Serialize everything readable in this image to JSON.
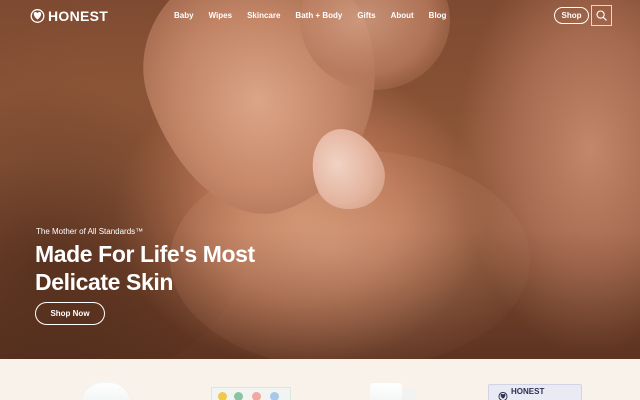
{
  "nav": {
    "brand": "HONEST",
    "logo_icon": "butterfly-icon",
    "links": [
      "Baby",
      "Wipes",
      "Skincare",
      "Bath + Body",
      "Gifts",
      "About",
      "Blog"
    ],
    "shop_label": "Shop",
    "search_icon": "search-icon"
  },
  "hero": {
    "eyebrow": "The Mother of All Standards™",
    "headline": "Made For Life's Most Delicate Skin",
    "cta_label": "Shop Now"
  },
  "products": {
    "packaging_brand": "HONEST"
  },
  "colors": {
    "text_on_hero": "#ffffff",
    "product_strip_bg": "#f8f2ea",
    "hero_skin": "#b77352"
  }
}
